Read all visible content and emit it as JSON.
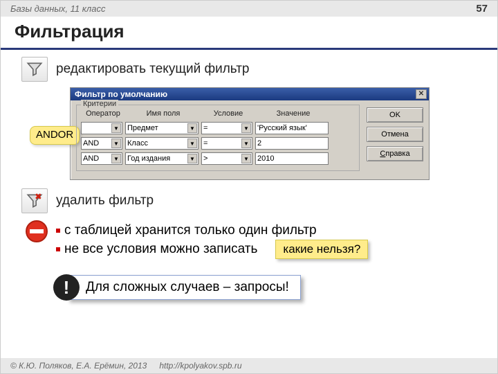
{
  "header": {
    "breadcrumb": "Базы данных, 11 класс",
    "page": "57"
  },
  "title": "Фильтрация",
  "labels": {
    "edit_filter": "редактировать текущий фильтр",
    "delete_filter": "удалить фильтр"
  },
  "and_or_badge": "ANDOR",
  "dialog": {
    "title": "Фильтр по умолчанию",
    "group": "Критерии",
    "headers": {
      "operator": "Оператор",
      "field": "Имя поля",
      "condition": "Условие",
      "value": "Значение"
    },
    "rows": [
      {
        "operator": "",
        "field": "Предмет",
        "condition": "=",
        "value": "'Русский язык'"
      },
      {
        "operator": "AND",
        "field": "Класс",
        "condition": "=",
        "value": "2"
      },
      {
        "operator": "AND",
        "field": "Год издания",
        "condition": ">",
        "value": "2010"
      }
    ],
    "buttons": {
      "ok": "OK",
      "cancel": "Отмена",
      "help": "Справка",
      "help_u": "С"
    }
  },
  "bullets": {
    "b1": "с таблицей хранится только один фильтр",
    "b2": "не все условия можно записать"
  },
  "question": "какие нельзя?",
  "complex": "Для сложных случаев – запросы!",
  "excl": "!",
  "footer": {
    "copyright": "© К.Ю. Поляков, Е.А. Ерёмин, 2013",
    "url": "http://kpolyakov.spb.ru"
  },
  "icons": {
    "funnel": "funnel-icon",
    "funnel_x": "funnel-remove-icon",
    "no_entry": "no-entry-icon"
  }
}
